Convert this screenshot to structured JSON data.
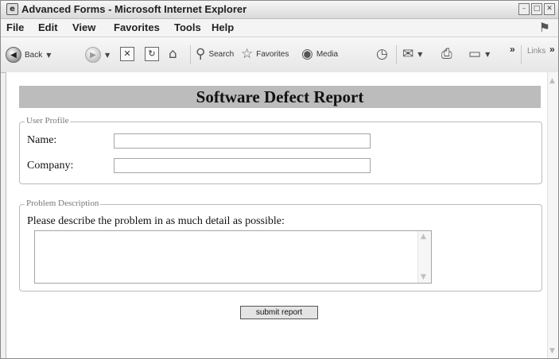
{
  "window": {
    "title": "Advanced Forms - Microsoft Internet Explorer",
    "icon": "ie-page-icon"
  },
  "menu": [
    "File",
    "Edit",
    "View",
    "Favorites",
    "Tools",
    "Help"
  ],
  "toolbar": {
    "back": "Back",
    "search": "Search",
    "favorites": "Favorites",
    "media": "Media",
    "overflow": "»",
    "links": "Links"
  },
  "page": {
    "heading": "Software Defect Report",
    "user_profile": {
      "legend": "User Profile",
      "name_label": "Name:",
      "name_value": "",
      "company_label": "Company:",
      "company_value": ""
    },
    "problem": {
      "legend": "Problem Description",
      "prompt": "Please describe the problem in as much detail as possible:",
      "value": ""
    },
    "submit_label": "submit report"
  },
  "colors": {
    "heading_bg": "#bcbcbc",
    "page_bg": "#ffffff",
    "chrome_bg": "#f1f1f1"
  }
}
